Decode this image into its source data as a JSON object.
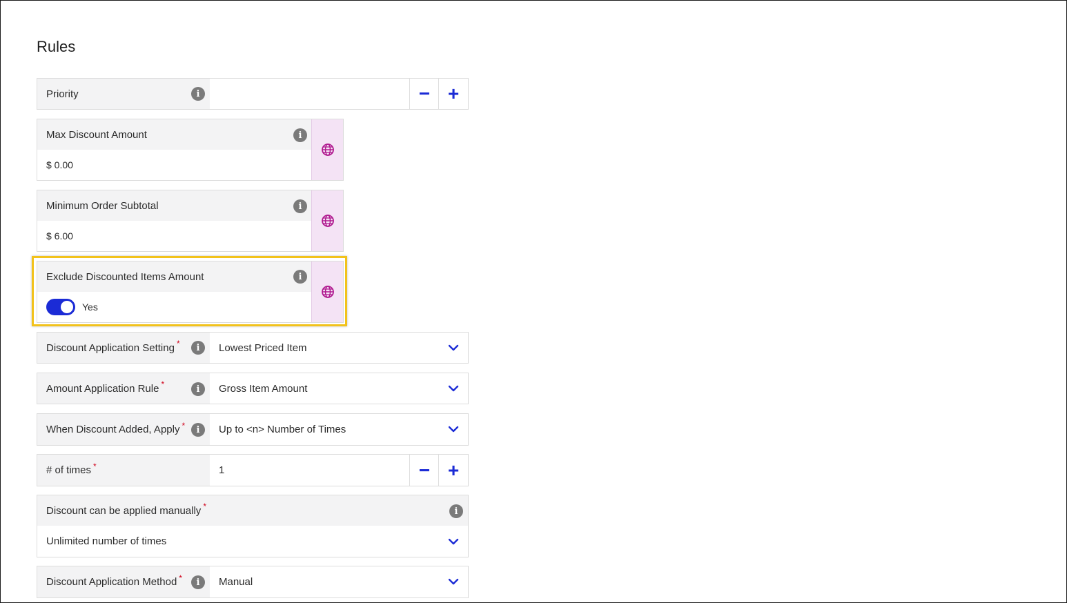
{
  "section": {
    "title": "Rules"
  },
  "priority": {
    "label": "Priority",
    "value": "",
    "minus": "−",
    "plus": "+"
  },
  "max_discount": {
    "label": "Max Discount Amount",
    "value": "$ 0.00"
  },
  "min_subtotal": {
    "label": "Minimum Order Subtotal",
    "value": "$ 6.00"
  },
  "exclude_discounted": {
    "label": "Exclude Discounted Items Amount",
    "toggle_state": "on",
    "toggle_label": "Yes"
  },
  "discount_application_setting": {
    "label": "Discount Application Setting",
    "required": "*",
    "value": "Lowest Priced Item"
  },
  "amount_application_rule": {
    "label": "Amount Application Rule",
    "required": "*",
    "value": "Gross Item Amount"
  },
  "when_discount_added": {
    "label": "When Discount Added, Apply",
    "required": "*",
    "value": "Up to <n> Number of Times"
  },
  "num_times": {
    "label": "# of times",
    "required": "*",
    "value": "1",
    "minus": "−",
    "plus": "+"
  },
  "applied_manually": {
    "label": "Discount can be applied manually",
    "required": "*",
    "value": "Unlimited number of times"
  },
  "discount_application_method": {
    "label": "Discount Application Method",
    "required": "*",
    "value": "Manual"
  },
  "colors": {
    "accent": "#1b2bd6",
    "globe": "#b0198f",
    "highlight": "#f2c21b",
    "required": "#d0021b"
  },
  "icons": {
    "info": "info-icon",
    "globe": "globe-icon",
    "chevron": "chevron-down-icon"
  }
}
